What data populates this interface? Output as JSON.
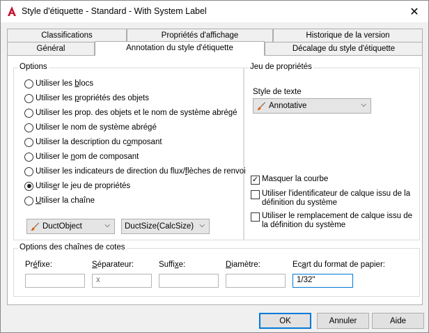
{
  "window": {
    "title": "Style d'étiquette - Standard - With System Label",
    "close_glyph": "✕"
  },
  "tabs": {
    "row1": [
      "Classifications",
      "Propriétés d'affichage",
      "Historique de la version"
    ],
    "row2": [
      "Général",
      "Annotation du style d'étiquette",
      "Décalage du style d'étiquette"
    ],
    "active": "Annotation du style d'étiquette"
  },
  "options": {
    "title": "Options",
    "radios": [
      {
        "pre": "Utiliser les ",
        "u": "b",
        "post": "locs",
        "checked": false
      },
      {
        "pre": "Utiliser les ",
        "u": "p",
        "post": "ropriétés des objets",
        "checked": false
      },
      {
        "pre": "Utiliser les prop. des objets et le nom de système abrégé",
        "u": "",
        "post": "",
        "checked": false
      },
      {
        "pre": "Utiliser le nom de système abrégé",
        "u": "",
        "post": "",
        "checked": false
      },
      {
        "pre": "Utiliser la description du c",
        "u": "o",
        "post": "mposant",
        "checked": false
      },
      {
        "pre": "Utiliser le ",
        "u": "n",
        "post": "om de composant",
        "checked": false
      },
      {
        "pre": "Utiliser les indicateurs de direction du flux/",
        "u": "f",
        "post": "lèches de renvoi",
        "checked": false
      },
      {
        "pre": "Utilis",
        "u": "e",
        "post": "r le jeu de propriétés",
        "checked": true
      },
      {
        "pre": "",
        "u": "U",
        "post": "tiliser la chaîne",
        "checked": false
      }
    ],
    "combo_propset": "DuctObject",
    "combo_prop": "DuctSize(CalcSize)"
  },
  "propset": {
    "title": "Jeu de propriétés",
    "text_style_label": "Style de texte",
    "text_style_value": "Annotative",
    "checks": [
      {
        "label": "Masquer la courbe",
        "checked": true
      },
      {
        "label": "Utiliser l'identificateur de calque issu de la définition du système",
        "checked": false
      },
      {
        "label": "Utiliser le remplacement de calque issu de la définition du système",
        "checked": false
      }
    ]
  },
  "dimensions": {
    "title": "Options des chaînes de cotes",
    "prefix_label": "Préfixe:",
    "separator_label": "Séparateur:",
    "suffix_label": "Suffixe:",
    "diameter_label": "Diamètre:",
    "gap_label": "Ecart du format de papier:",
    "prefix_value": "",
    "separator_value": "x",
    "suffix_value": "",
    "diameter_value": "",
    "gap_value": "1/32\""
  },
  "buttons": {
    "ok": "OK",
    "cancel": "Annuler",
    "help": "Aide"
  },
  "colors": {
    "accent": "#0078d7",
    "autocad_red": "#c8102e"
  }
}
